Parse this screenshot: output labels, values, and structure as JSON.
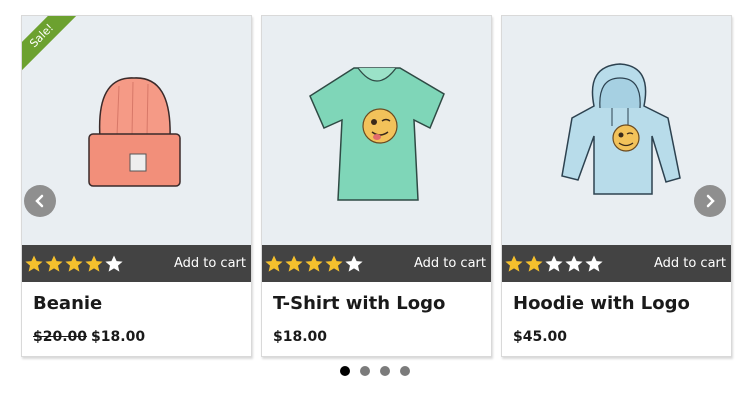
{
  "products": [
    {
      "name": "Beanie",
      "old_price": "$20.00",
      "price": "$18.00",
      "rating": 4,
      "rating_max": 5,
      "badge": "Sale!",
      "cart_label": "Add to cart",
      "image_icon": "beanie-hat-icon"
    },
    {
      "name": "T-Shirt with Logo",
      "old_price": "",
      "price": "$18.00",
      "rating": 4,
      "rating_max": 5,
      "cart_label": "Add to cart",
      "image_icon": "tshirt-icon"
    },
    {
      "name": "Hoodie with Logo",
      "old_price": "",
      "price": "$45.00",
      "rating": 2,
      "rating_max": 5,
      "cart_label": "Add to cart",
      "image_icon": "hoodie-icon"
    }
  ],
  "carousel": {
    "page_count": 4,
    "active_page": 1,
    "prev_icon": "chevron-left-icon",
    "next_icon": "chevron-right-icon"
  },
  "colors": {
    "bar": "#434343",
    "star_filled": "#f5c02d",
    "star_empty": "#ffffff",
    "sale_badge": "#6ca12f",
    "image_bg": "#e9eef2"
  }
}
